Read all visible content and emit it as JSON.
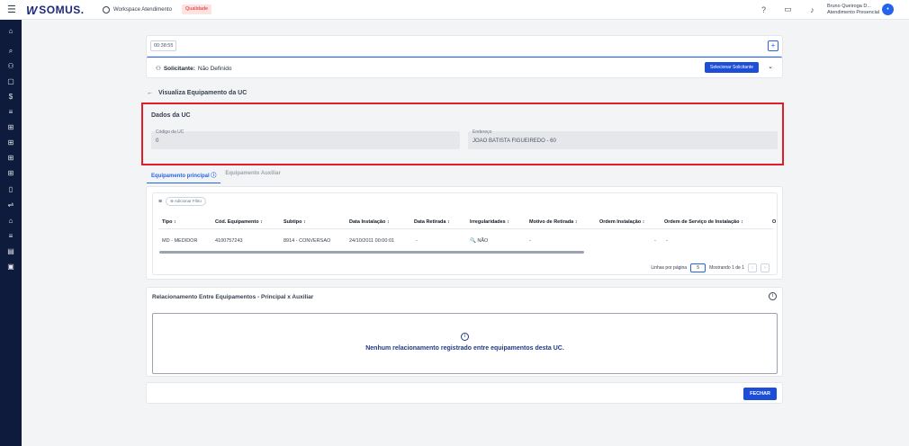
{
  "header": {
    "logo_mark": "W",
    "logo_text": "SOMUS.",
    "workspace": "Workspace Atendimento",
    "badge": "Qualidade",
    "user_name": "Bruno Queiroga D...",
    "user_role": "Atendimento Presencial",
    "icons": [
      "help-icon",
      "inbox-icon",
      "bell-icon"
    ]
  },
  "sidebar": {
    "icons": [
      "home-icon",
      "search-icon",
      "users-icon",
      "clipboard-icon",
      "dollar-icon",
      "list-icon",
      "grid-icon",
      "grid-icon",
      "grid-icon",
      "grid-icon",
      "document-icon",
      "transfer-icon",
      "home-icon",
      "list-icon",
      "note-icon",
      "card-icon"
    ]
  },
  "timer": "00:38:55",
  "solicitante": {
    "label": "Solicitante:",
    "value": "Não Definido",
    "button": "Selecionar Solicitante"
  },
  "page_title": "Visualiza Equipamento da UC",
  "uc": {
    "title": "Dados da UC",
    "codigo_label": "Código da UC",
    "codigo_value": "0",
    "endereco_label": "Endereço",
    "endereco_value": "JOAO BATISTA FIGUEIREDO - 60"
  },
  "tabs": [
    {
      "label": "Equipamento principal ⓘ",
      "active": true
    },
    {
      "label": "Equipamento Auxiliar",
      "active": false
    }
  ],
  "table": {
    "filter_chip": "⊕ Adicionar Filtro",
    "columns": [
      "Tipo ↕",
      "Cód. Equipamento ↕",
      "Subtipo ↕",
      "Data Instalação ↕",
      "Data Retirada ↕",
      "Irregularidades ↕",
      "Motivo de Retirada ↕",
      "Ordem Instalação ↕",
      "Ordem de Serviço de Instalação ↕",
      "O"
    ],
    "rows": [
      [
        "MD - MEDIDOR",
        "4100757243",
        "8914 - CONVERSAO",
        "24/10/2011 00:00:01",
        "-",
        "🔍 NÃO",
        "-",
        "-",
        "-"
      ]
    ],
    "rows_per_page_label": "Linhas por página",
    "rows_per_page": "5",
    "showing": "Mostrando 1 de 1"
  },
  "relacionamento": {
    "title": "Relacionamento Entre Equipamentos - Principal x Auxiliar",
    "empty_message": "Nenhum relacionamento registrado entre equipamentos desta UC."
  },
  "footer": {
    "close_button": "FECHAR"
  }
}
